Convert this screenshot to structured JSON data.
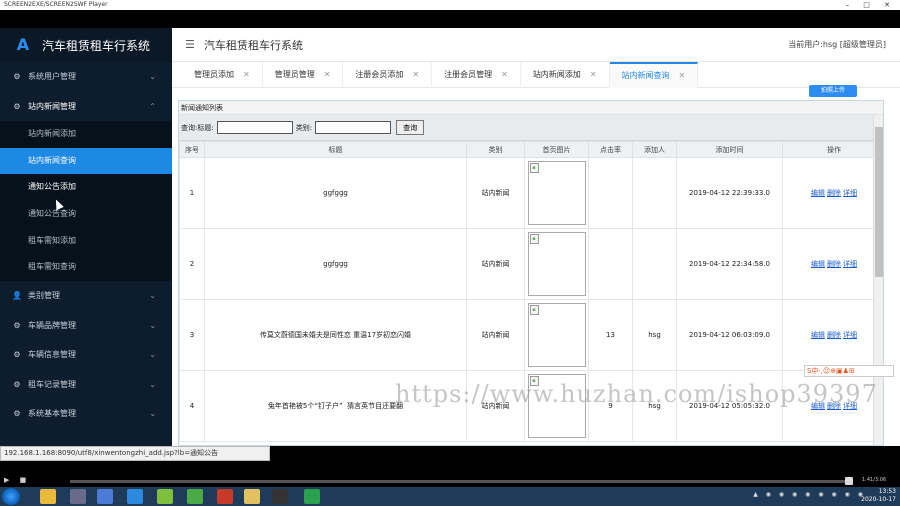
{
  "player": {
    "title": "SCREEN2EXE/SCREEN2SWF Player",
    "window_controls": "– □ ✕",
    "time": "1:41/3:06"
  },
  "brand": {
    "title": "汽车租赁租车行系统",
    "logo": "A"
  },
  "header": {
    "title": "汽车租赁租车行系统",
    "user": "当前用户:hsg [超级管理员]"
  },
  "sidebar": {
    "items": [
      {
        "label": "系统用户管理",
        "icon": "gear-icon",
        "glyph": "⚙",
        "chev": "⌄"
      },
      {
        "label": "站内新闻管理",
        "icon": "gear-icon",
        "glyph": "⚙",
        "chev": "⌃"
      },
      {
        "label": "类别管理",
        "icon": "user-icon",
        "glyph": "👤",
        "chev": "⌄"
      },
      {
        "label": "车辆品牌管理",
        "icon": "gear-icon",
        "glyph": "⚙",
        "chev": "⌄"
      },
      {
        "label": "车辆信息管理",
        "icon": "gear-icon",
        "glyph": "⚙",
        "chev": "⌄"
      },
      {
        "label": "租车记录管理",
        "icon": "gear-icon",
        "glyph": "⚙",
        "chev": "⌄"
      },
      {
        "label": "系统基本管理",
        "icon": "gear-icon",
        "glyph": "⚙",
        "chev": "⌄"
      }
    ],
    "sub_items": [
      {
        "label": "站内新闻添加"
      },
      {
        "label": "站内新闻查询"
      },
      {
        "label": "通知公告添加"
      },
      {
        "label": "通知公告查询"
      },
      {
        "label": "租车需知添加"
      },
      {
        "label": "租车需知查询"
      }
    ]
  },
  "tabs": [
    {
      "label": "管理员添加"
    },
    {
      "label": "管理员管理"
    },
    {
      "label": "注册会员添加"
    },
    {
      "label": "注册会员管理"
    },
    {
      "label": "站内新闻添加"
    },
    {
      "label": "站内新闻查询"
    }
  ],
  "content": {
    "upload_label": "拍照上传",
    "frame_title": "新闻通知列表",
    "search": {
      "label_title": "查询:标题:",
      "label_category": "类别:",
      "button": "查询"
    },
    "columns": [
      "序号",
      "标题",
      "类别",
      "首页图片",
      "点击率",
      "添加人",
      "添加时间",
      "操作"
    ],
    "rows": [
      {
        "no": "1",
        "title": "ggfggg",
        "category": "站内新闻",
        "clicks": "",
        "adder": "",
        "time": "2019-04-12 22:39:33.0"
      },
      {
        "no": "2",
        "title": "ggfggg",
        "category": "站内新闻",
        "clicks": "",
        "adder": "",
        "time": "2019-04-12 22:34:58.0"
      },
      {
        "no": "3",
        "title": "传莫文蔚德国未婚夫是同性恋 重温17岁初恋闪婚",
        "category": "站内新闻",
        "clicks": "13",
        "adder": "hsg",
        "time": "2019-04-12 06:03:09.0"
      },
      {
        "no": "4",
        "title": "兔年首艳被5个“钉子户”  猜言英节目还要翻",
        "category": "站内新闻",
        "clicks": "9",
        "adder": "hsg",
        "time": "2019-04-12 05:05:32.0"
      }
    ],
    "ops": {
      "edit": "编辑",
      "delete": "删除",
      "detail": "详细"
    }
  },
  "watermark": "https://www.huzhan.com/ishop39397",
  "ime": "S中·,☺⊕▣♟⊞",
  "statusbar": "192.168.1.168:8090/utf8/xinwentongzhi_add.jsp?lb=通知公告",
  "clock": {
    "time": "13:53",
    "date": "2020-10-17"
  },
  "colors": {
    "sidebar_bg": "#0e1d2e",
    "accent": "#1e88e5",
    "link": "#1a5ccc"
  }
}
